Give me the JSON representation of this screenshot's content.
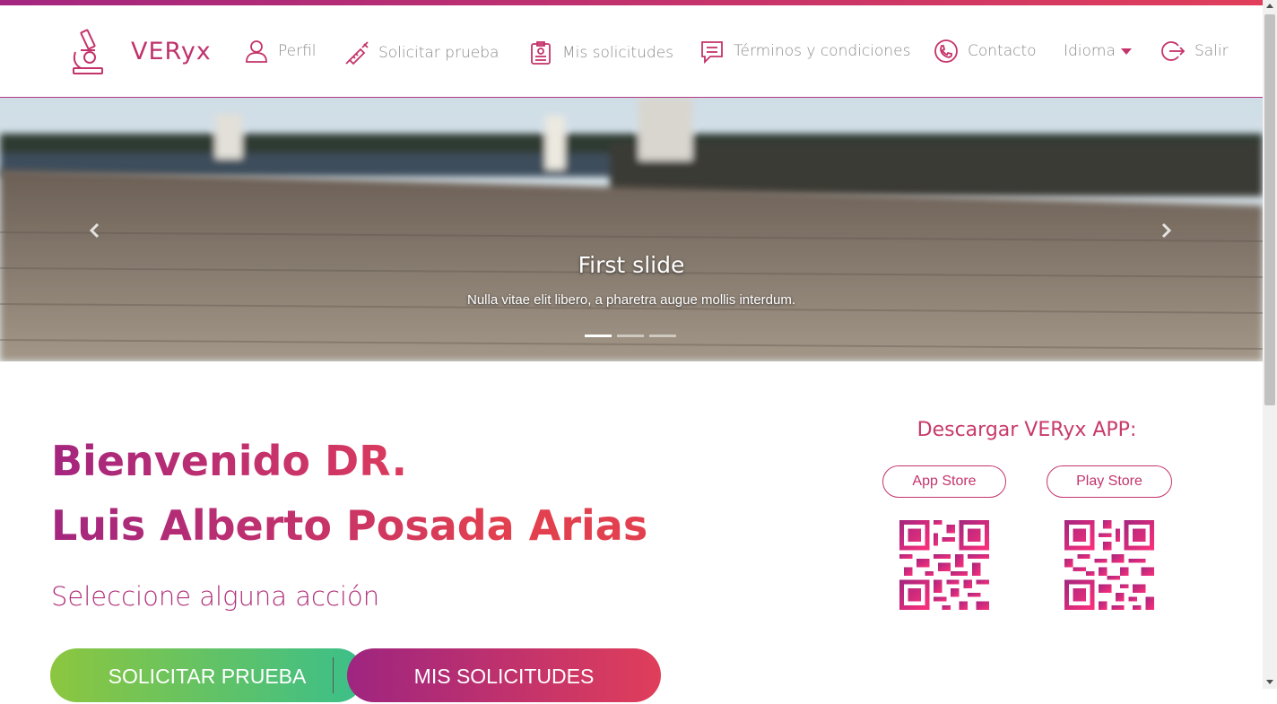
{
  "brand": {
    "name": "VERyx",
    "logo_icon": "microscope-icon",
    "accent": "#c0336d"
  },
  "nav": {
    "items": [
      {
        "label": "Perfil",
        "icon": "user-icon"
      },
      {
        "label": "Solicitar prueba",
        "icon": "syringe-icon"
      },
      {
        "label": "Mis solicitudes",
        "icon": "clipboard-icon"
      },
      {
        "label": "Términos y condiciones",
        "icon": "message-icon"
      },
      {
        "label": "Contacto",
        "icon": "phone-icon"
      },
      {
        "label": "Idioma",
        "icon": "caret-down-icon"
      },
      {
        "label": "Salir",
        "icon": "logout-icon"
      }
    ]
  },
  "carousel": {
    "title": "First slide",
    "text": "Nulla vitae elit libero, a pharetra augue mollis interdum.",
    "slide_count": 3,
    "active_index": 0
  },
  "welcome": {
    "line1": "Bienvenido DR.",
    "line2": "Luis Alberto Posada Arias",
    "subtitle": "Seleccione alguna acción"
  },
  "actions": {
    "solicitar": "SOLICITAR PRUEBA",
    "mis": "MIS SOLICITUDES"
  },
  "app_download": {
    "title": "Descargar VERyx APP:",
    "app_store": "App Store",
    "play_store": "Play Store"
  },
  "colors": {
    "gradient_start": "#a3267f",
    "gradient_end": "#e03e5a",
    "green_start": "#8cc63f",
    "green_end": "#3bbf8a"
  }
}
